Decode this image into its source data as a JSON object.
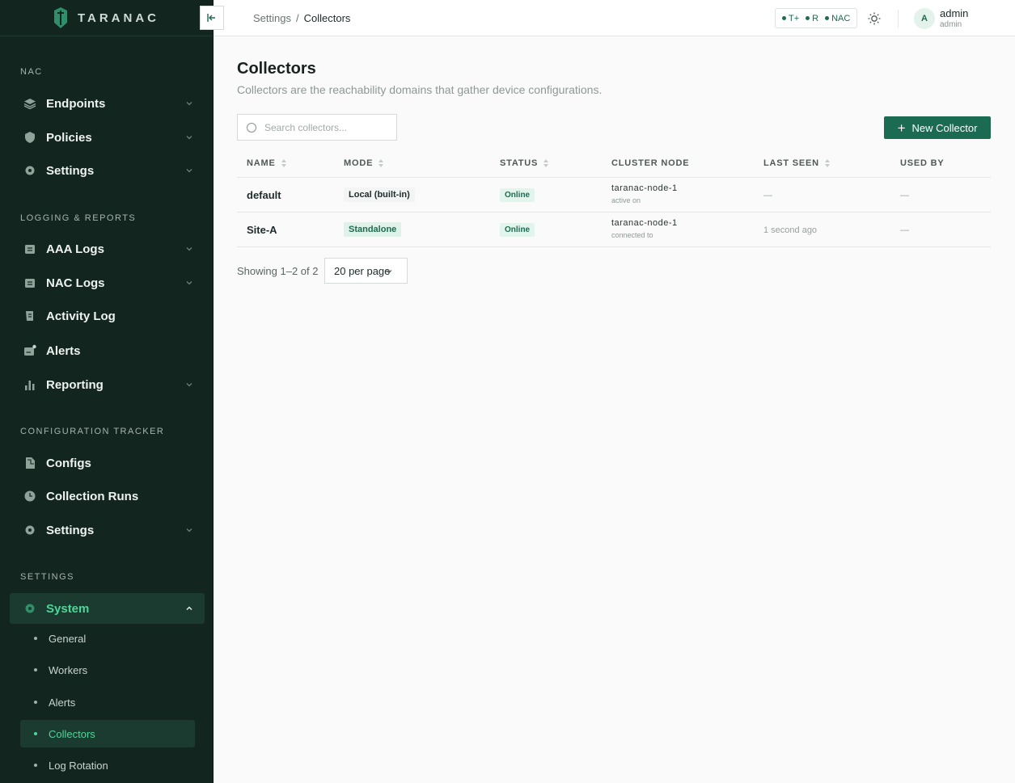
{
  "brand": {
    "name": "TARANAC"
  },
  "sidebar": {
    "sections": [
      {
        "title": "NAC",
        "items": [
          {
            "label": "Endpoints",
            "icon": "layers-icon"
          },
          {
            "label": "Policies",
            "icon": "shield-icon"
          },
          {
            "label": "Settings",
            "icon": "gear-icon"
          }
        ]
      },
      {
        "title": "LOGGING & REPORTS",
        "items": [
          {
            "label": "AAA Logs",
            "icon": "calendar-icon"
          },
          {
            "label": "NAC Logs",
            "icon": "calendar-icon"
          },
          {
            "label": "Activity Log",
            "icon": "scroll-icon"
          },
          {
            "label": "Alerts",
            "icon": "alert-icon"
          },
          {
            "label": "Reporting",
            "icon": "bar-chart-icon"
          }
        ]
      },
      {
        "title": "CONFIGURATION TRACKER",
        "items": [
          {
            "label": "Configs",
            "icon": "file-icon"
          },
          {
            "label": "Collection Runs",
            "icon": "clock-icon"
          },
          {
            "label": "Settings",
            "icon": "gear-icon"
          }
        ]
      },
      {
        "title": "SETTINGS",
        "items": [
          {
            "label": "System",
            "icon": "gear-icon"
          }
        ]
      }
    ],
    "system_subitems": [
      "General",
      "Workers",
      "Alerts",
      "Collectors",
      "Log Rotation"
    ]
  },
  "topbar": {
    "breadcrumb": [
      "Settings",
      "Collectors"
    ],
    "breadcrumb_sep": "/",
    "protocols": [
      "T+",
      "R",
      "NAC"
    ],
    "user": {
      "initial": "A",
      "name": "admin",
      "role": "admin"
    }
  },
  "main": {
    "title": "Collectors",
    "subtitle": "Collectors are the reachability domains that gather device configurations.",
    "search_placeholder": "Search collectors...",
    "new_button": "New Collector",
    "columns": [
      "NAME",
      "MODE",
      "STATUS",
      "CLUSTER NODE",
      "LAST SEEN",
      "USED BY"
    ],
    "rows": [
      {
        "name": "default",
        "mode": "Local (built-in)",
        "status": "Online",
        "node": "taranac-node-1",
        "node_sub": "active on",
        "last_seen": "—",
        "used_by": "—"
      },
      {
        "name": "Site-A",
        "mode": "Standalone",
        "status": "Online",
        "node": "taranac-node-1",
        "node_sub": "connected to",
        "last_seen": "1 second ago",
        "used_by": "—"
      }
    ],
    "showing": "Showing 1–2 of 2",
    "per_page": "20 per page"
  },
  "colors": {
    "sidebar_bg": "#13251f",
    "accent": "#1b6b52",
    "active_text": "#4fd59a"
  }
}
